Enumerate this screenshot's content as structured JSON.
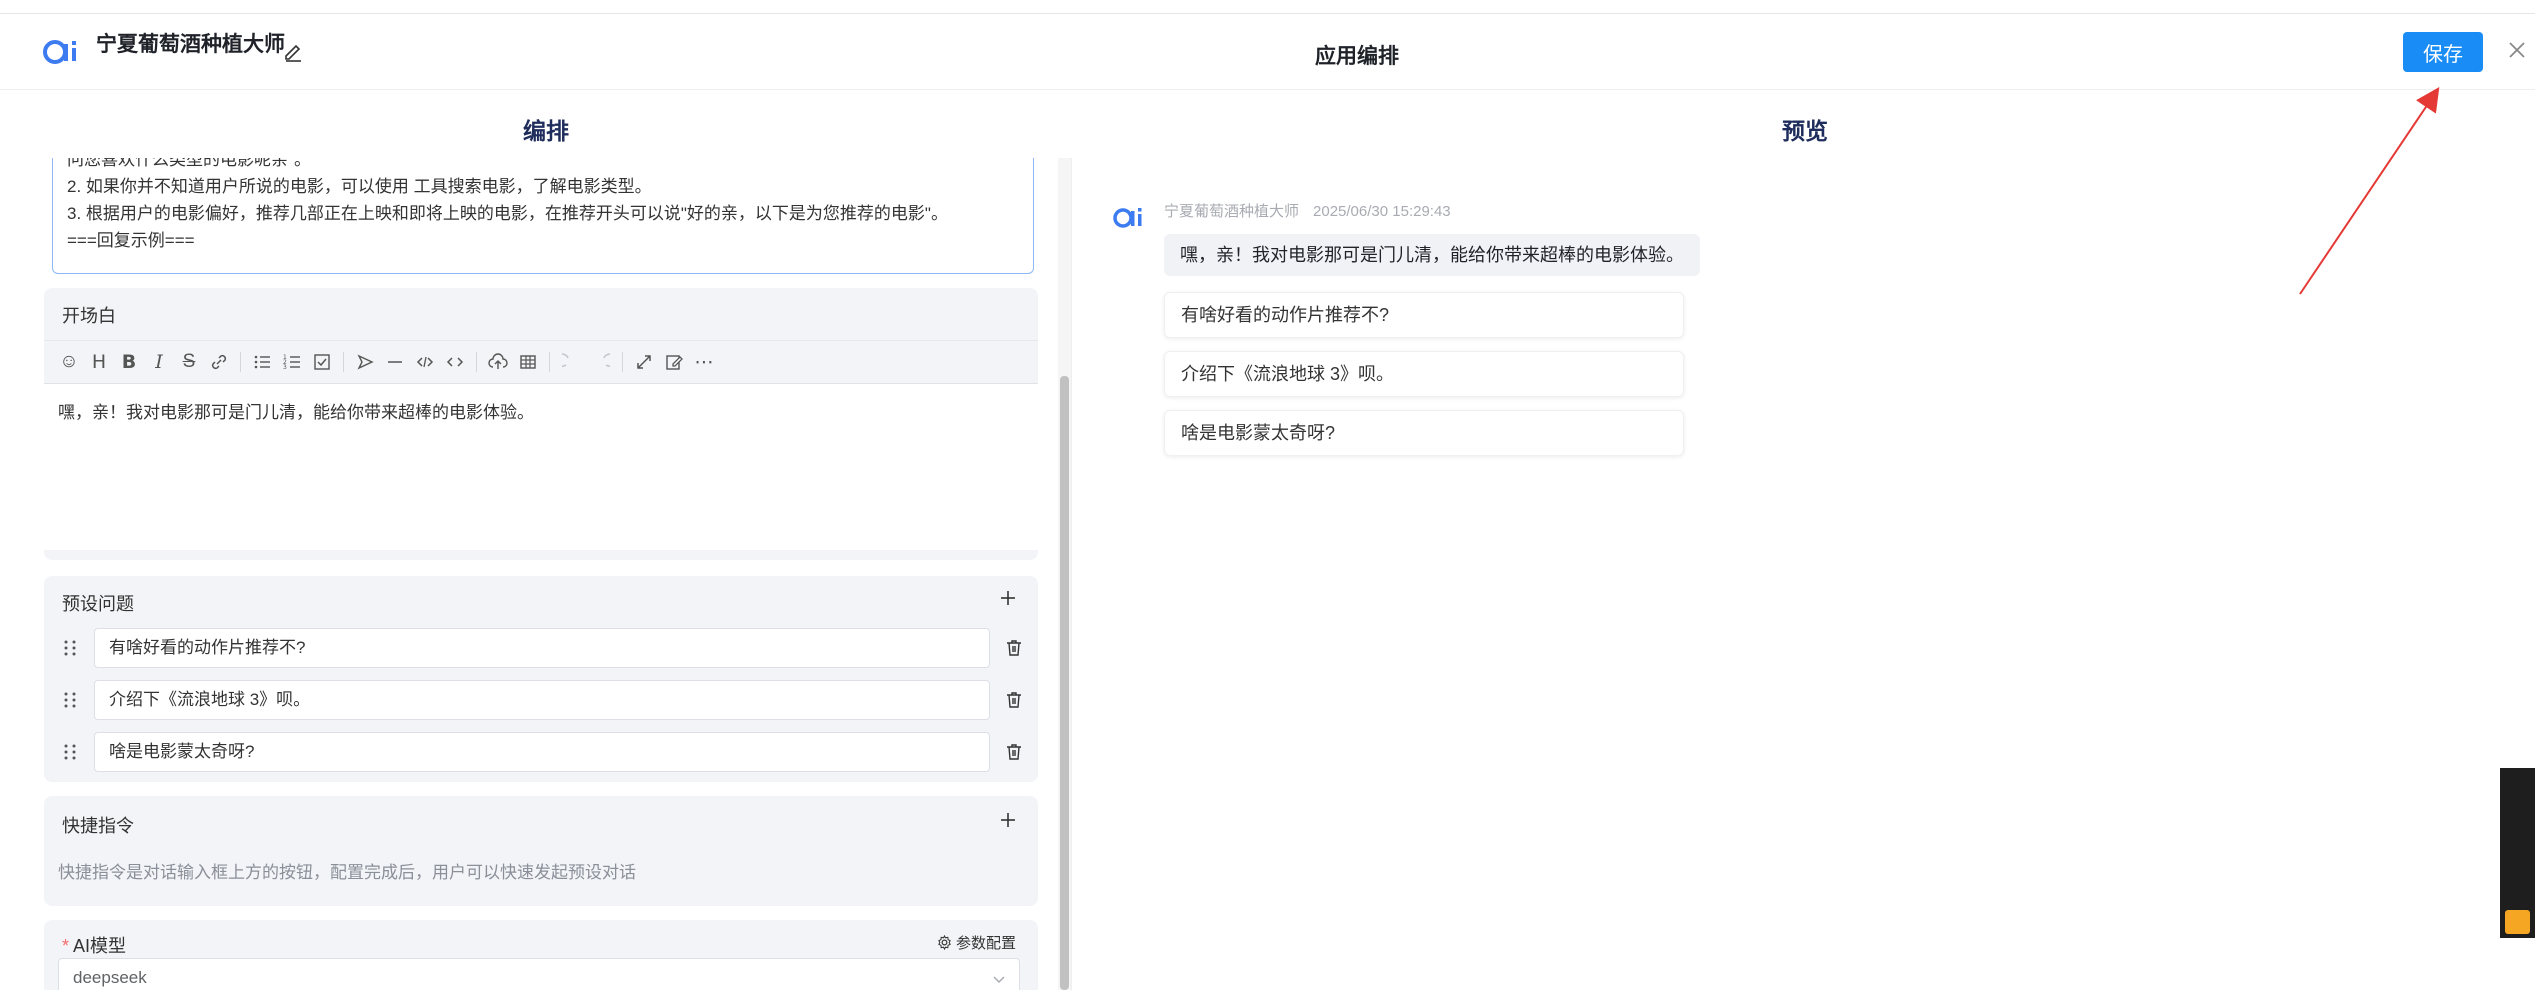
{
  "header": {
    "app_name": "宁夏葡萄酒种植大师",
    "title": "应用编排",
    "save_label": "保存"
  },
  "columns": {
    "edit_title": "编排",
    "preview_title": "预览"
  },
  "prompt": {
    "line1": "问您喜欢什么类型的电影呢亲\"。",
    "line2": "2. 如果你并不知道用户所说的电影，可以使用 工具搜索电影，了解电影类型。",
    "line3": "3. 根据用户的电影偏好，推荐几部正在上映和即将上映的电影，在推荐开头可以说\"好的亲，以下是为您推荐的电影\"。",
    "line4": "===回复示例==="
  },
  "opening": {
    "label": "开场白",
    "content": "嘿，亲！我对电影那可是门儿清，能给你带来超棒的电影体验。"
  },
  "preset": {
    "label": "预设问题",
    "questions": [
      "有啥好看的动作片推荐不?",
      "介绍下《流浪地球 3》呗。",
      "啥是电影蒙太奇呀?"
    ]
  },
  "quick": {
    "label": "快捷指令",
    "desc": "快捷指令是对话输入框上方的按钮，配置完成后，用户可以快速发起预设对话"
  },
  "model": {
    "required_mark": "*",
    "label": "AI模型",
    "param_label": "参数配置",
    "value": "deepseek"
  },
  "preview": {
    "sender": "宁夏葡萄酒种植大师",
    "time": "2025/06/30 15:29:43",
    "greeting": "嘿，亲！我对电影那可是门儿清，能给你带来超棒的电影体验。",
    "questions": [
      "有啥好看的动作片推荐不?",
      "介绍下《流浪地球 3》呗。",
      "啥是电影蒙太奇呀?"
    ]
  },
  "colors": {
    "primary": "#1a8cf5",
    "annotation": "#e53935"
  }
}
